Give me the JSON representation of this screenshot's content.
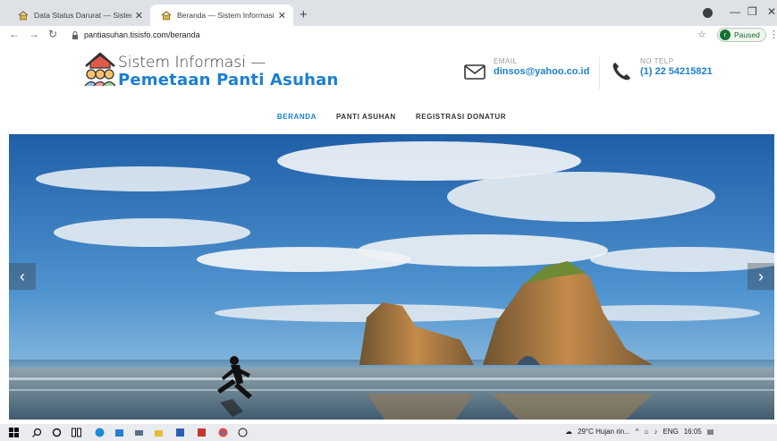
{
  "browser": {
    "tabs": [
      {
        "title": "Data Status Darurat — Sistem Inf",
        "active": false
      },
      {
        "title": "Beranda — Sistem Informasi Pem",
        "active": true
      }
    ],
    "url": "pantiasuhan.tisisfo.com/beranda",
    "profile_initial": "r",
    "profile_status": "Paused"
  },
  "site": {
    "brand_line1": "Sistem Informasi —",
    "brand_line2": "Pemetaan Panti Asuhan",
    "email_label": "EMAIL",
    "email_value": "dinsos@yahoo.co.id",
    "phone_label": "NO TELP",
    "phone_value": "(1) 22 54215821",
    "nav": [
      {
        "label": "BERANDA",
        "active": true
      },
      {
        "label": "PANTI ASUHAN",
        "active": false
      },
      {
        "label": "REGISTRASI DONATUR",
        "active": false
      }
    ],
    "accent_color": "#1c7fd1"
  },
  "hero": {
    "prev_label": "‹",
    "next_label": "›"
  },
  "taskbar": {
    "weather": "29°C  Hujan rin...",
    "language": "ENG",
    "time": "16:05"
  }
}
